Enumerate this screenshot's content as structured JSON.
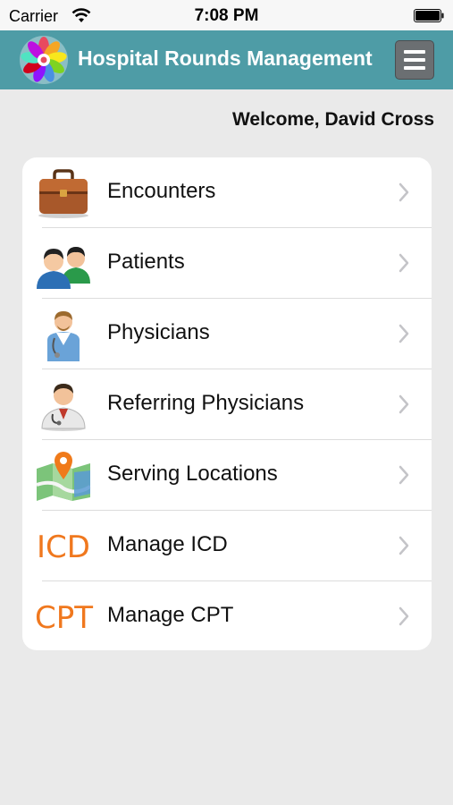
{
  "status_bar": {
    "carrier": "Carrier",
    "time": "7:08 PM"
  },
  "nav_bar": {
    "title": "Hospital Rounds Management",
    "color": "#4e9ca6"
  },
  "welcome_text": "Welcome, David Cross",
  "menu": {
    "items": [
      {
        "label": "Encounters",
        "icon": "briefcase-icon"
      },
      {
        "label": "Patients",
        "icon": "patients-icon"
      },
      {
        "label": "Physicians",
        "icon": "physician-icon"
      },
      {
        "label": "Referring Physicians",
        "icon": "doctor-icon"
      },
      {
        "label": "Serving Locations",
        "icon": "map-pin-icon"
      },
      {
        "label": "Manage ICD",
        "icon": "icd-icon",
        "icon_text": "ICD"
      },
      {
        "label": "Manage CPT",
        "icon": "cpt-icon",
        "icon_text": "CPT"
      }
    ],
    "icon_text_color": "#f0781e"
  }
}
